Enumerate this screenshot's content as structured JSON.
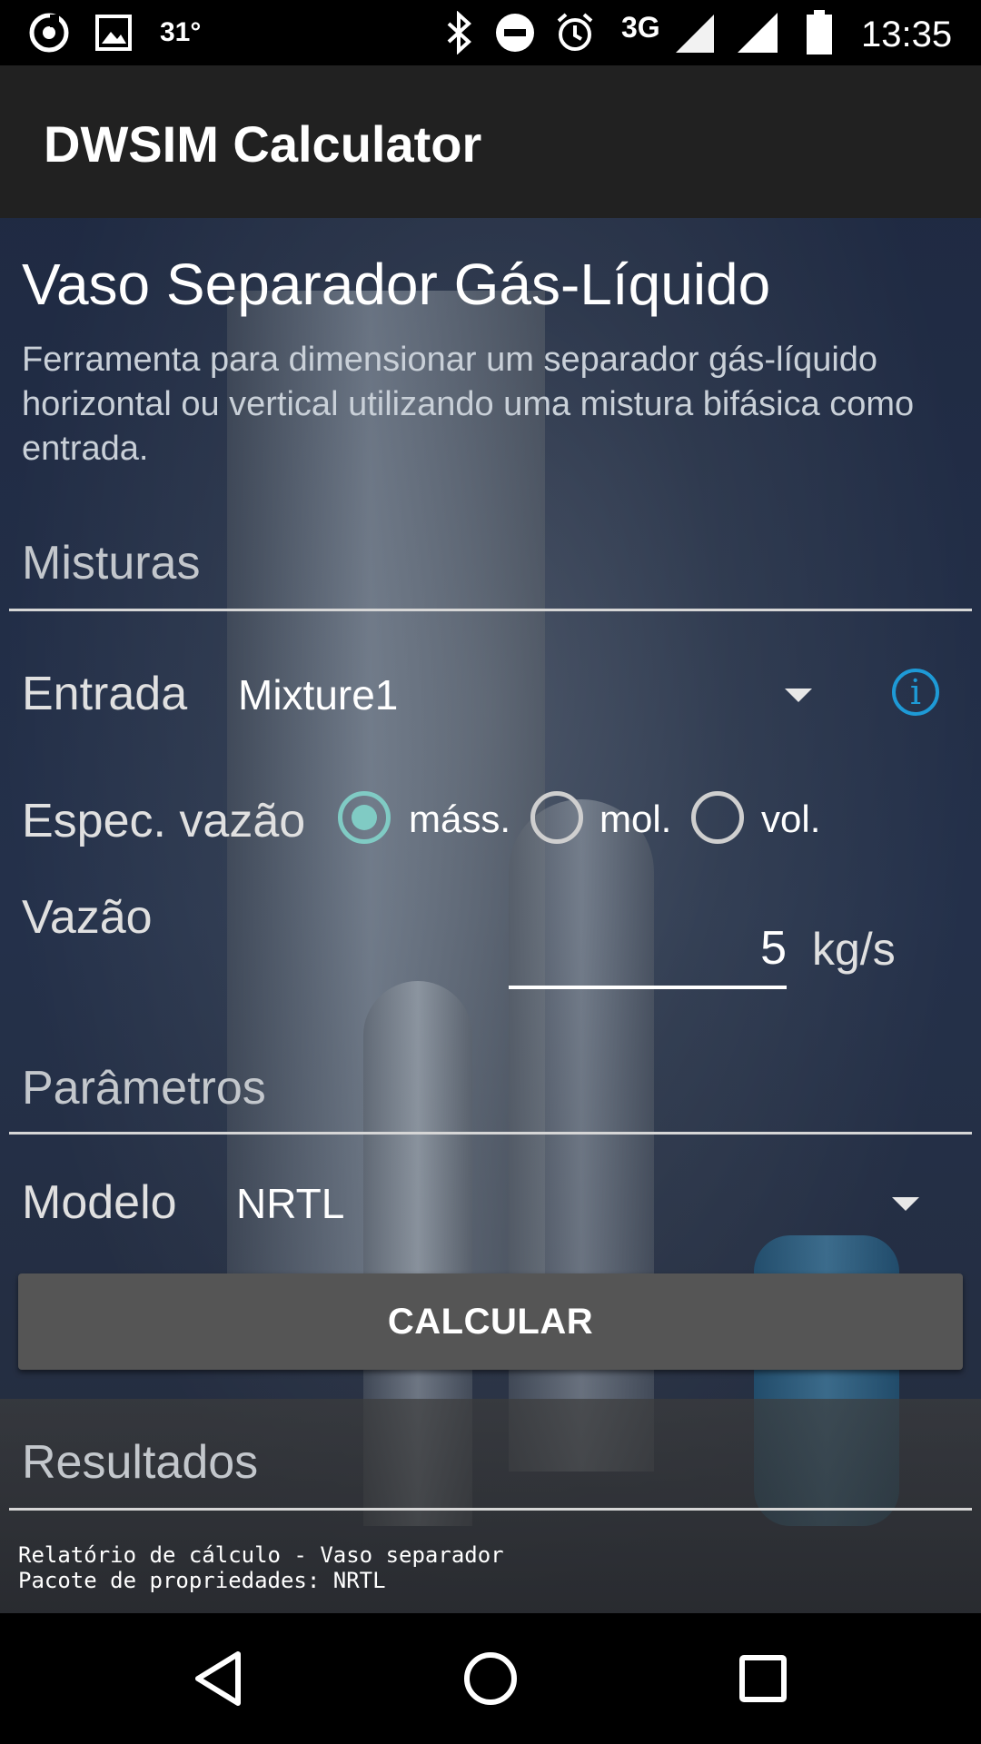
{
  "status_bar": {
    "notification_icons": [
      "sync-icon",
      "image-icon"
    ],
    "temperature": "31°",
    "system_icons": [
      "bluetooth-icon",
      "do-not-disturb-icon",
      "alarm-icon",
      "signal-icon",
      "signal-icon",
      "battery-icon"
    ],
    "network": "3G",
    "time": "13:35"
  },
  "app_bar": {
    "title": "DWSIM Calculator"
  },
  "page": {
    "title": "Vaso Separador Gás-Líquido",
    "description": "Ferramenta para dimensionar um separador gás-líquido horizontal ou vertical utilizando uma mistura bifásica como entrada."
  },
  "mixtures": {
    "section_label": "Misturas",
    "entrada_label": "Entrada",
    "entrada_value": "Mixture1",
    "flow_spec_label": "Espec. vazão",
    "flow_spec_options": [
      {
        "label": "máss.",
        "checked": true
      },
      {
        "label": "mol.",
        "checked": false
      },
      {
        "label": "vol.",
        "checked": false
      }
    ],
    "flow_label": "Vazão",
    "flow_value": "5",
    "flow_unit": "kg/s"
  },
  "parameters": {
    "section_label": "Parâmetros",
    "model_label": "Modelo",
    "model_value": "NRTL"
  },
  "calculate_button": "CALCULAR",
  "results": {
    "section_label": "Resultados",
    "lines": [
      "Relatório de cálculo - Vaso separador",
      "Pacote de propriedades: NRTL"
    ]
  },
  "colors": {
    "accent": "#80cbc4",
    "info": "#1e9ad6",
    "app_bar": "#212121",
    "button": "#555555"
  },
  "nav_bar": {
    "icons": [
      "back-icon",
      "home-icon",
      "recents-icon"
    ]
  }
}
